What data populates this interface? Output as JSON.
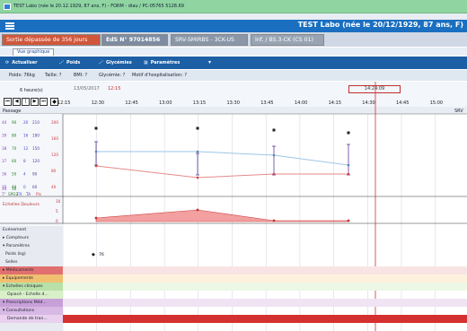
{
  "window": {
    "title": "TEST Labo (née le 20.12.1929, 87 ans, F) - FORM - diau / PC-05765 5128.69"
  },
  "patient_bar": {
    "title": "TEST Labo (née le 20/12/1929, 87 ans, F)"
  },
  "tabs": [
    {
      "label": "Sortie dépassée de 356 jours",
      "color": "#d0573b"
    },
    {
      "label": "EdS N° 97014856",
      "color": "#7d8ca0"
    },
    {
      "label": "SRV-SMIRBS - 3CK-US",
      "color": "#8a97a8"
    },
    {
      "label": "Inf. / BS.3-CK (CS 01)",
      "color": "#98a4b3"
    }
  ],
  "view_tab": "Vue graphique",
  "toolbar": {
    "actualiser": "Actualiser",
    "poids": "Poids",
    "glycemies": "Glycémies",
    "parametres": "Paramètres"
  },
  "info": {
    "poids": "Poids: 76kg",
    "taille": "Taille: ?",
    "bmi": "BMI: ?",
    "glycemie": "Glycémie: ?",
    "motif": "Motif d'hospitalisation: ?"
  },
  "timeline": {
    "zoom": "6 heure(s)",
    "date": "13/05/2017",
    "start_time": "12:15",
    "current_time": "14:24:09",
    "ticks": [
      "12:15",
      "12:30",
      "12:45",
      "13:00",
      "13:15",
      "13:30",
      "13:45",
      "14:00",
      "14:15",
      "14:30",
      "14:45",
      "15:00"
    ]
  },
  "passage": {
    "label": "Passage",
    "right_label": "SRV"
  },
  "axes": {
    "col1": [
      "40",
      "39",
      "38",
      "37",
      "36",
      "35"
    ],
    "col2": [
      "90",
      "80",
      "70",
      "60",
      "50",
      "40"
    ],
    "col3": [
      "20",
      "16",
      "12",
      "8",
      "4",
      "0"
    ],
    "col4": [
      "210",
      "180",
      "150",
      "120",
      "90",
      "60"
    ],
    "col5": [
      "200",
      "160",
      "120",
      "80",
      "40"
    ],
    "col1_bottom": "34",
    "col2_bottom": "30",
    "legend": [
      "T°",
      "SPO2",
      "FR",
      "TA",
      "Pls"
    ],
    "legend_colors": [
      "#8a4fc0",
      "#2a7d2a",
      "#4a4ad0",
      "#5c3aa0",
      "#d04040"
    ]
  },
  "pain_scale": {
    "label": "Echelles Douleurs",
    "yticks": [
      "10",
      "5",
      "0"
    ]
  },
  "sidebar": {
    "evenement": "Evénement",
    "compteurs": "Compteurs",
    "parametres": "Paramètres",
    "poids": "Poids (kg)",
    "poids_value": "76",
    "selles": "Selles",
    "medicaments": "Médicaments",
    "equipements": "Equipements",
    "echelles": "Echelles cliniques",
    "opiace": "Opiacé - Echelle d...",
    "prescriptions": "Prescriptions Méd...",
    "consultations": "Consultations",
    "demande": "Demande de tran..."
  }
}
